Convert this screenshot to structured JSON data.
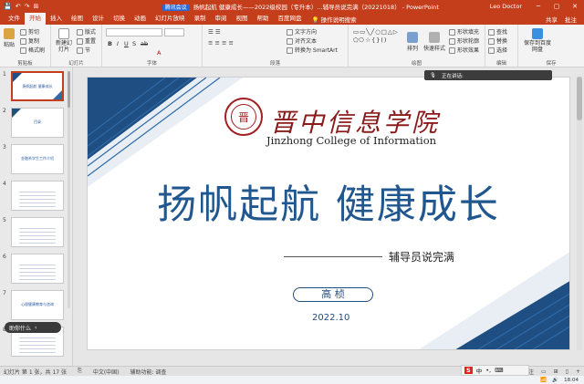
{
  "titlebar": {
    "doc_title": "扬帆起航 健康成长——2022级校园（专升本）...辅导员说完满（20221018）  -  PowerPoint",
    "rec_badge": "腾讯会议",
    "user": "Leo Doctor",
    "qat": [
      "💾",
      "↶",
      "↷",
      "⊞"
    ],
    "win_buttons": [
      "─",
      "▢",
      "✕"
    ]
  },
  "tabs": {
    "items": [
      "文件",
      "开始",
      "插入",
      "绘图",
      "设计",
      "切换",
      "动画",
      "幻灯片放映",
      "录制",
      "审阅",
      "视图",
      "帮助",
      "百度网盘"
    ],
    "active_index": 1,
    "search": "操作说明搜索",
    "share": "共享",
    "comments": "批注"
  },
  "ribbon": {
    "paste": "粘贴",
    "cut": "剪切",
    "copy": "复制",
    "format_painter": "格式刷",
    "clipboard": "剪贴板",
    "new_slide": "新建幻灯片",
    "layout": "版式",
    "reset": "重置",
    "section": "节",
    "slides": "幻灯片",
    "font": "字体",
    "text_direction": "文字方向",
    "align_text": "对齐文本",
    "smartart": "转换为 SmartArt",
    "paragraph": "段落",
    "drawing": "绘图",
    "arrange": "排列",
    "quick_styles": "快速样式",
    "shape_fill": "形状填充",
    "shape_outline": "形状轮廓",
    "shape_effects": "形状效果",
    "find": "查找",
    "replace": "替换",
    "select": "选择",
    "editing": "编辑",
    "save_baidu": "保存到百度网盘",
    "save_label": "保存"
  },
  "voice": {
    "status": "正在讲话:"
  },
  "thumbnails": [
    {
      "num": "1",
      "text": "扬帆起航 健康成长"
    },
    {
      "num": "2",
      "text": "目录"
    },
    {
      "num": "3",
      "text": "金融系学生工作介绍"
    },
    {
      "num": "4",
      "text": ""
    },
    {
      "num": "5",
      "text": ""
    },
    {
      "num": "6",
      "text": ""
    },
    {
      "num": "7",
      "text": "心理健康教育与咨询"
    },
    {
      "num": "8",
      "text": ""
    }
  ],
  "caption_pill": {
    "label": "助你什么",
    "arrow": "‹"
  },
  "slide": {
    "school_cn": "晋中信息学院",
    "school_en": "Jinzhong College of Information",
    "seal_char": "晋",
    "title": "扬帆起航  健康成长",
    "subtitle": "辅导员说完满",
    "name": "高 桢",
    "date": "2022.10"
  },
  "status": {
    "slide_count": "幻灯片 第 1 张，共 17 张",
    "language": "中文(中国)",
    "accessibility": "辅助功能: 调查",
    "notes": "备注",
    "zoom": "+"
  },
  "tray": {
    "ime": "S",
    "ime_mode": "中",
    "time": "18:04"
  },
  "colors": {
    "accent": "#c43e1c",
    "slide_blue": "#21578f",
    "seal_red": "#a31e22"
  }
}
